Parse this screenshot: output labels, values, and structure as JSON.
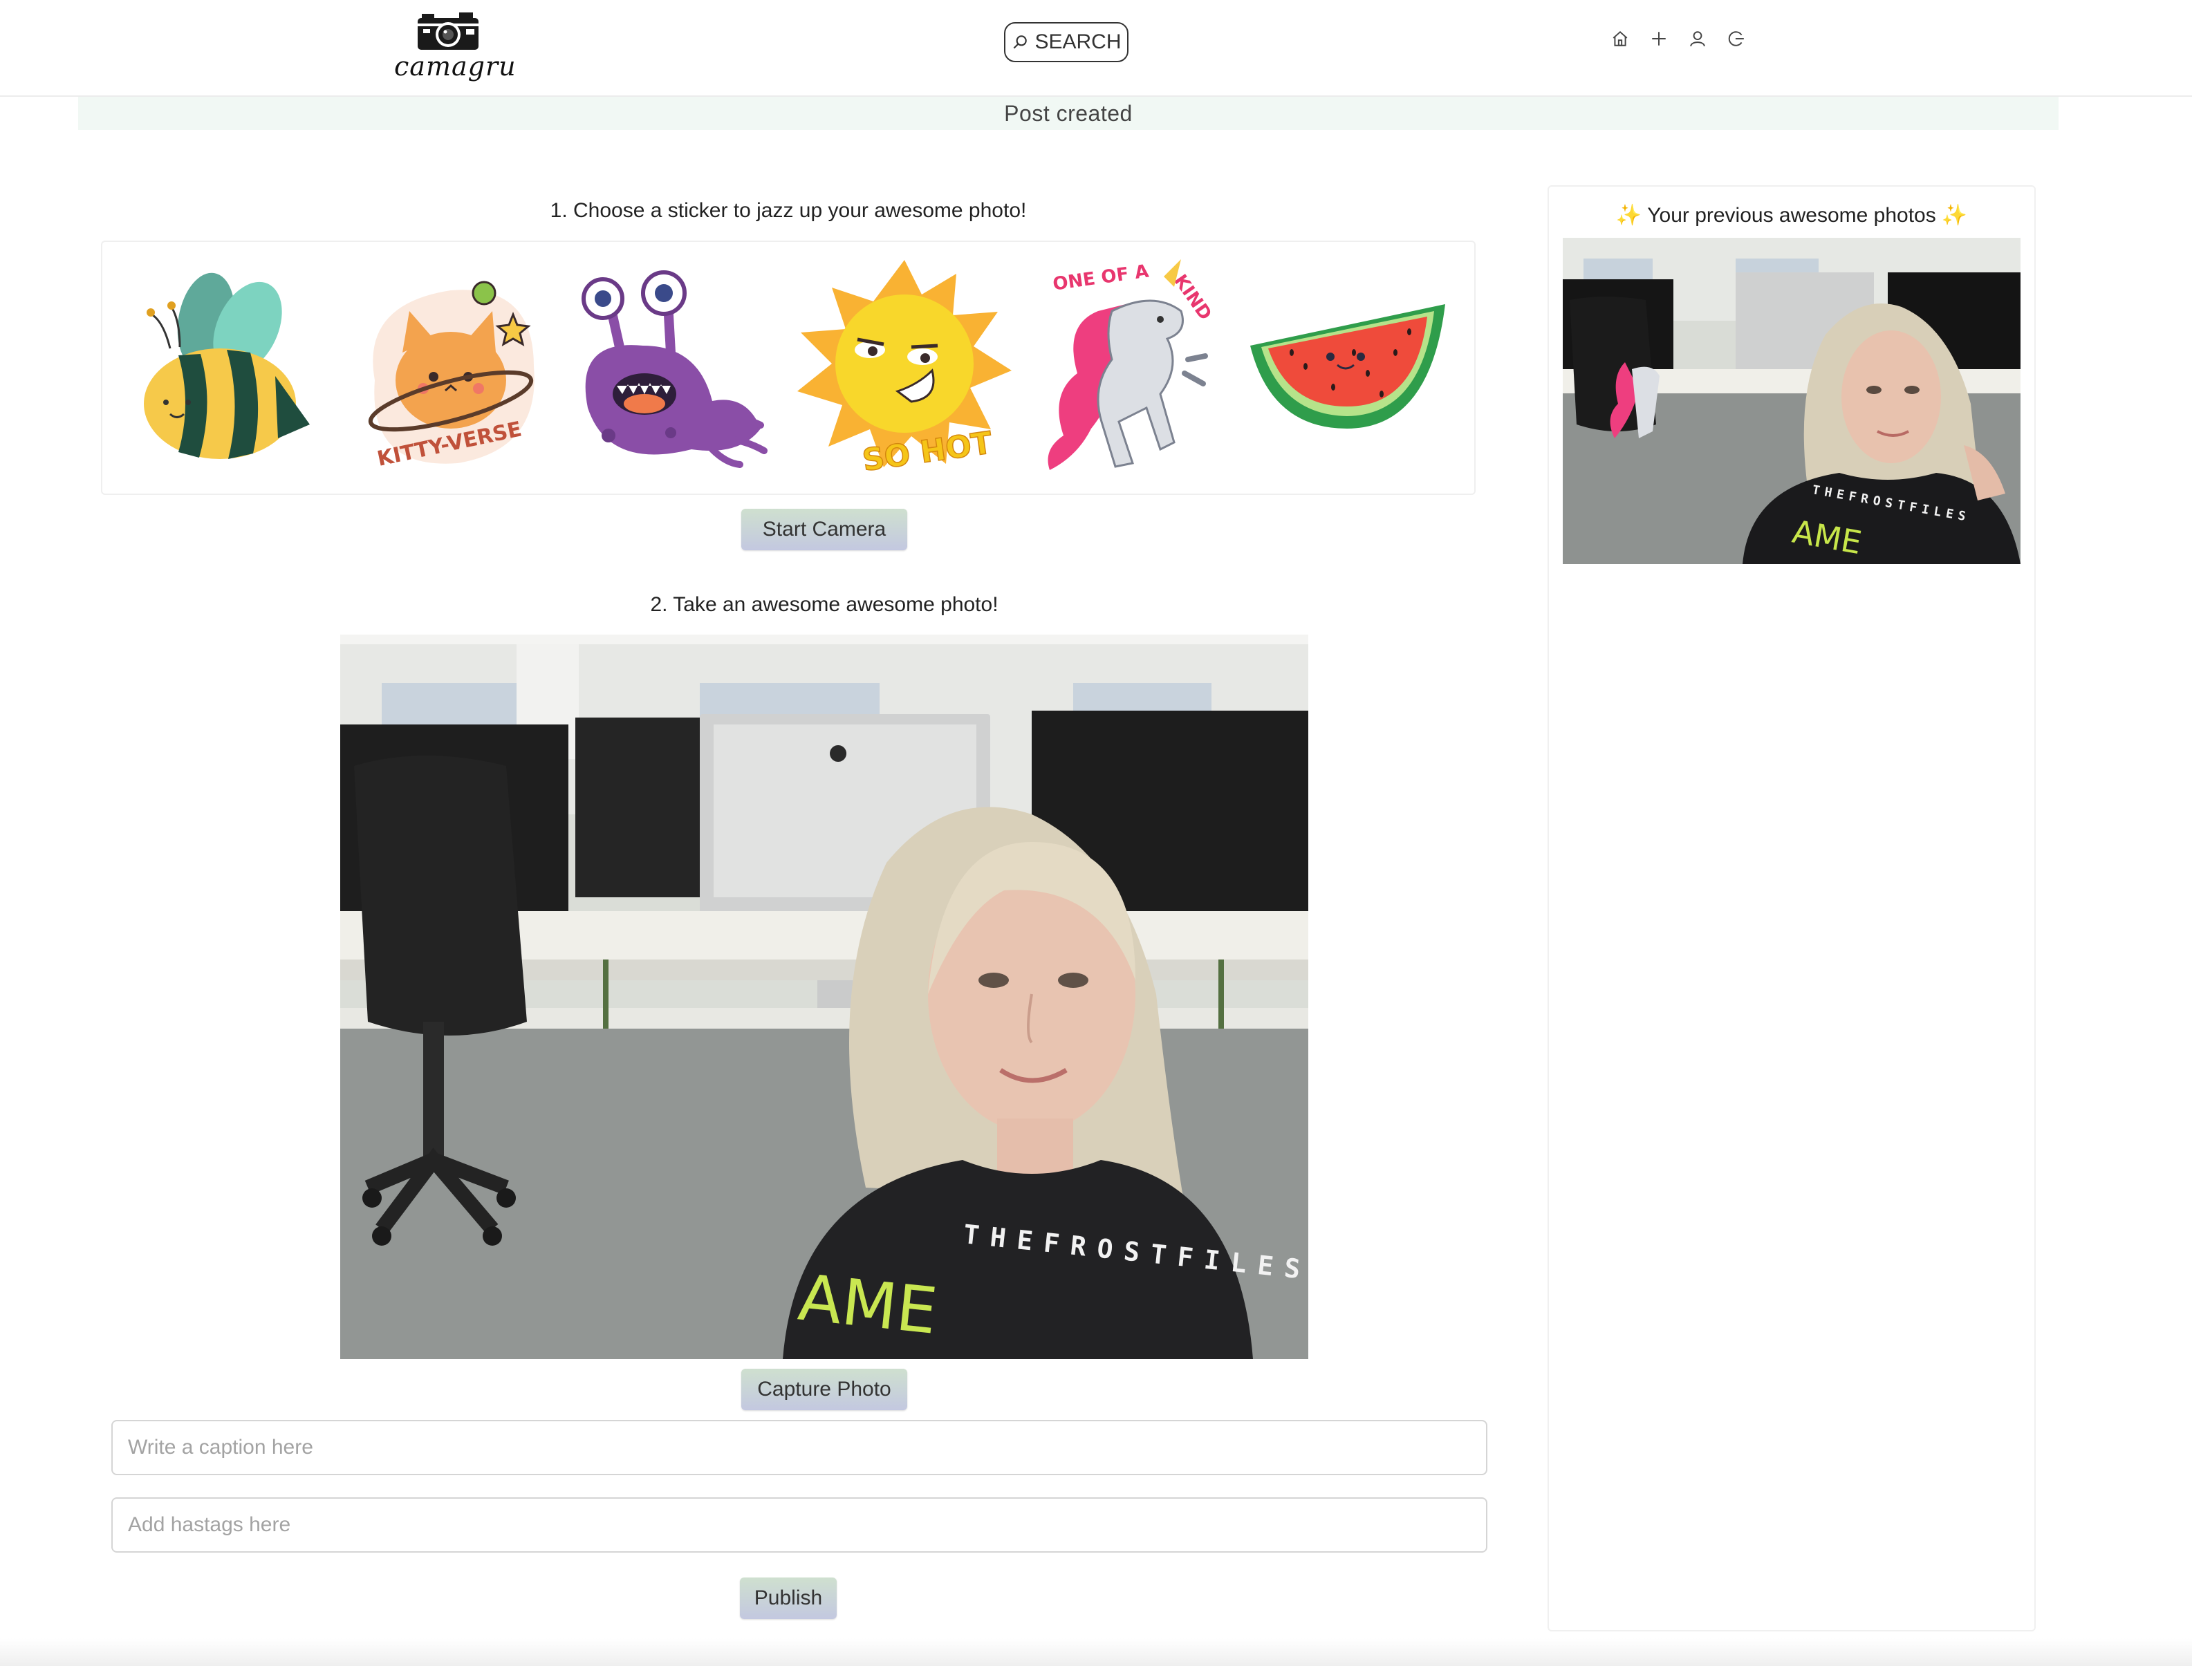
{
  "header": {
    "logo_text": "camagru",
    "search_label": "SEARCH",
    "nav": [
      {
        "icon": "home-icon"
      },
      {
        "icon": "plus-icon"
      },
      {
        "icon": "user-icon"
      },
      {
        "icon": "logout-icon"
      }
    ]
  },
  "alert": {
    "message": "Post created"
  },
  "stickers_section": {
    "title": "1. Choose a sticker to jazz up your awesome photo!",
    "stickers": [
      {
        "name": "bee-sticker"
      },
      {
        "name": "kitty-verse-sticker",
        "text": "KITTY-VERSE"
      },
      {
        "name": "purple-monster-sticker"
      },
      {
        "name": "sun-so-hot-sticker",
        "text": "SO HOT"
      },
      {
        "name": "unicorn-sticker",
        "text": "ONE OF A KIND"
      },
      {
        "name": "watermelon-sticker"
      }
    ],
    "start_camera_label": "Start Camera"
  },
  "photo_section": {
    "title": "2. Take an awesome awesome photo!",
    "shirt_text": "THEFROSTFILES_",
    "shirt_text_2": "AME",
    "capture_label": "Capture Photo",
    "caption_placeholder": "Write a caption here",
    "hashtags_placeholder": "Add hastags here",
    "publish_label": "Publish"
  },
  "sidebar": {
    "title": "Your previous awesome photos",
    "sparkle": "✨",
    "thumb_shirt_text": "THEFROSTFILES",
    "thumb_shirt_text_2": "AME"
  },
  "colors": {
    "button_gradient_top": "#cfe0cf",
    "button_gradient_bottom": "#c3c8e0",
    "alert_bg": "#f1f8f4"
  }
}
